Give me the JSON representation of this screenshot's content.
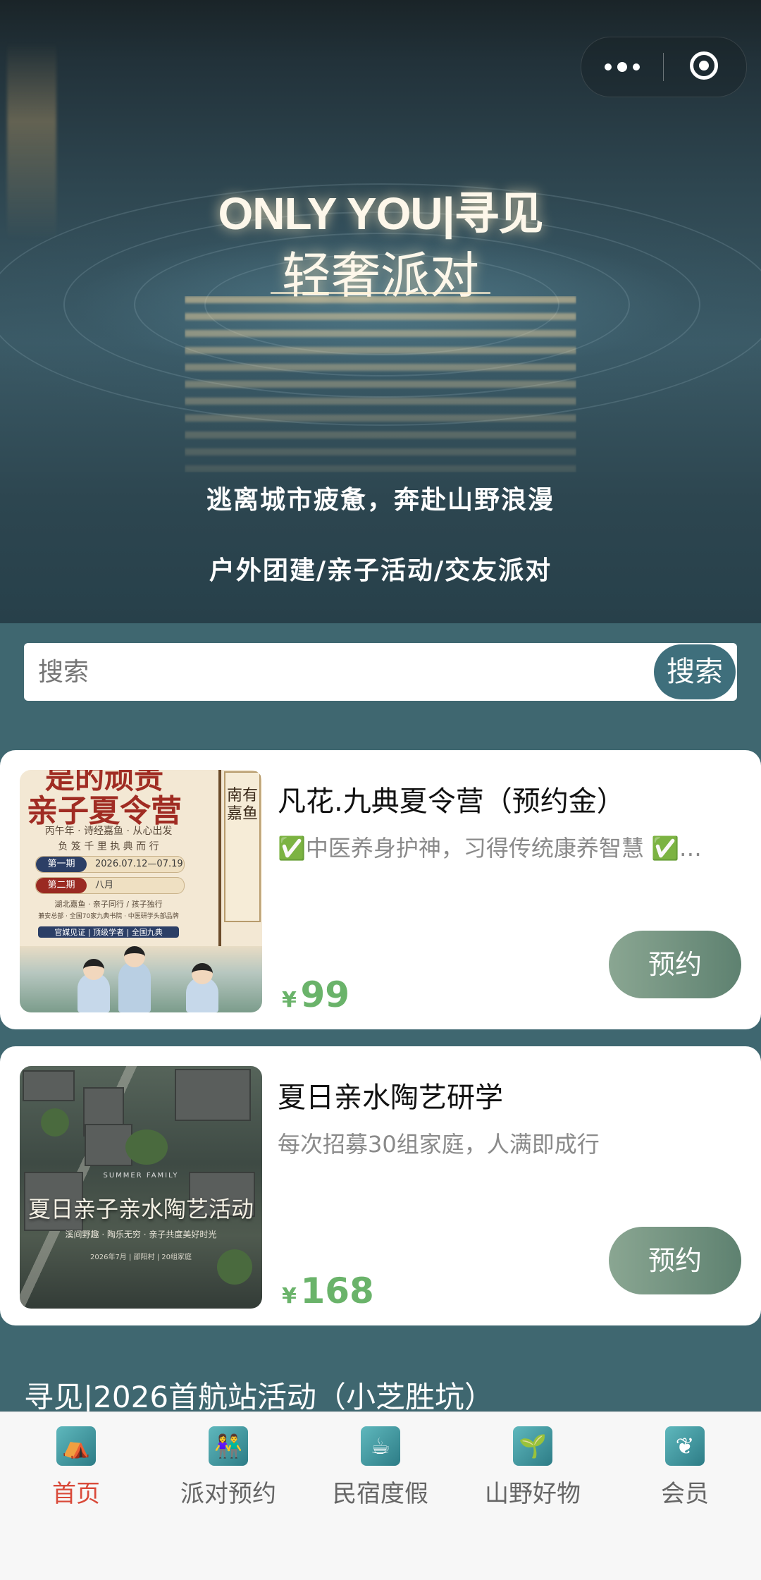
{
  "hero": {
    "title_en": "ONLY YOU|寻见",
    "title_cn": "轻奢派对",
    "tagline": "逃离城市疲惫，奔赴山野浪漫",
    "subtitle": "户外团建/亲子活动/交友派对"
  },
  "search": {
    "placeholder": "搜索",
    "button_label": "搜索"
  },
  "products": [
    {
      "title": "凡花.九典夏令营（预约金）",
      "description": "✅中医养身护神，习得传统康养智慧 ✅…",
      "price_symbol": "¥",
      "price": "99",
      "button_label": "预约",
      "poster": {
        "top": "是的顽贵",
        "main": "亲子夏令营",
        "line1": "丙午年 · 诗经嘉鱼 · 从心出发",
        "line2": "负 笈 千 里    执 典 而 行",
        "tag1": "第一期",
        "date1": "2026.07.12—07.19",
        "tag2": "第二期",
        "date2": "八月",
        "line3": "湖北嘉鱼 · 亲子同行 / 孩子独行",
        "line4": "兼安总部 · 全国70家九典书院 · 中医研学头部品牌",
        "line5": "官媒见证 | 顶级学者 | 全国九典",
        "banner": "南有嘉鱼"
      }
    },
    {
      "title": "夏日亲水陶艺研学",
      "description": "每次招募30组家庭，人满即成行",
      "price_symbol": "¥",
      "price": "168",
      "button_label": "预约",
      "poster": {
        "small": "SUMMER FAMILY",
        "main": "夏日亲子亲水陶艺活动",
        "sub": "溪间野趣 · 陶乐无穷 · 亲子共度美好时光",
        "sub2": "2026年7月 | 邵阳村 | 20组家庭"
      }
    }
  ],
  "section_title": "寻见|2026首航站活动（小芝胜坑）",
  "tabbar": {
    "items": [
      {
        "label": "首页",
        "icon": "tent-icon",
        "active": true
      },
      {
        "label": "派对预约",
        "icon": "people-icon",
        "active": false
      },
      {
        "label": "民宿度假",
        "icon": "coffee-icon",
        "active": false
      },
      {
        "label": "山野好物",
        "icon": "plant-icon",
        "active": false
      },
      {
        "label": "会员",
        "icon": "leaf-hand-icon",
        "active": false
      }
    ]
  },
  "colors": {
    "page_bg": "#3f6770",
    "accent_red": "#d94a3a",
    "price_green": "#6ab36a",
    "button_green": "#6f8f7d",
    "search_button": "#3f6f7c"
  }
}
